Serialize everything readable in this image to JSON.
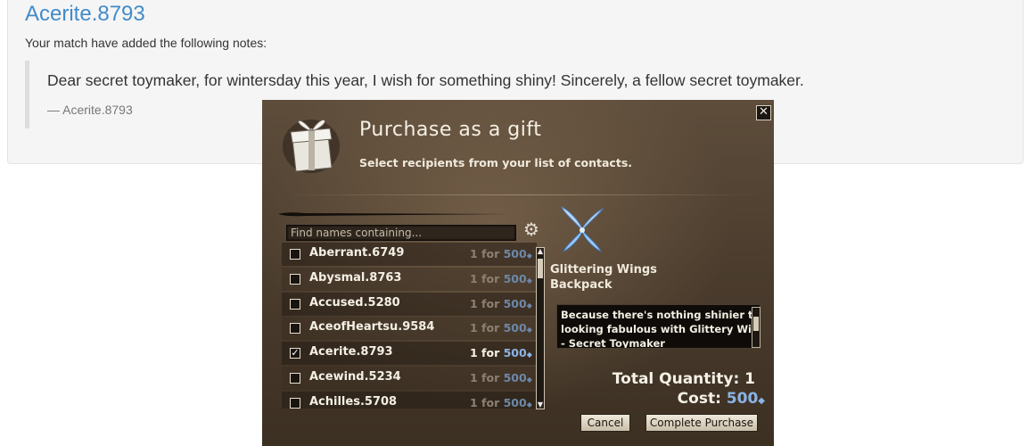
{
  "page": {
    "match_name": "Acerite.8793",
    "notes_intro": "Your match have added the following notes:",
    "quote_text": "Dear secret toymaker, for wintersday this year, I wish for something shiny! Sincerely, a fellow secret toymaker.",
    "quote_footer": "— Acerite.8793"
  },
  "dialog": {
    "title": "Purchase as a gift",
    "subtitle": "Select recipients from your list of contacts.",
    "close_glyph": "✕",
    "search_placeholder": "Find names containing...",
    "contacts": [
      {
        "name": "Aberrant.6749",
        "qty": "1 for",
        "price": "500",
        "checked": false
      },
      {
        "name": "Abysmal.8763",
        "qty": "1 for",
        "price": "500",
        "checked": false
      },
      {
        "name": "Accused.5280",
        "qty": "1 for",
        "price": "500",
        "checked": false
      },
      {
        "name": "AceofHeartsu.9584",
        "qty": "1 for",
        "price": "500",
        "checked": false
      },
      {
        "name": "Acerite.8793",
        "qty": "1 for",
        "price": "500",
        "checked": true
      },
      {
        "name": "Acewind.5234",
        "qty": "1 for",
        "price": "500",
        "checked": false
      },
      {
        "name": "Achilles.5708",
        "qty": "1 for",
        "price": "500",
        "checked": false
      }
    ],
    "gem_glyph": "◆",
    "item_name": "Glittering Wings Backpack",
    "note": "Because there's nothing shinier than\nlooking fabulous with Glittery Wings!\n- Secret Toymaker",
    "total_quantity_label": "Total Quantity: 1",
    "cost_label": "Cost:",
    "cost_value": "500",
    "cancel_label": "Cancel",
    "complete_label": "Complete Purchase",
    "icons": {
      "gift": "gift-box-icon",
      "wings": "glittering-wings-icon",
      "settings": "gear-icon"
    }
  }
}
